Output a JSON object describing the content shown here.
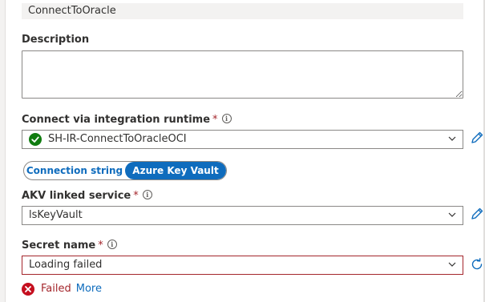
{
  "name_field": {
    "value": "ConnectToOracle"
  },
  "description": {
    "label": "Description",
    "value": ""
  },
  "integration_runtime": {
    "label": "Connect via integration runtime",
    "required_mark": "*",
    "info_icon": "info-icon",
    "selected": "SH-IR-ConnectToOracleOCI",
    "status_icon": "check-circle-icon",
    "status_color": "#107c10"
  },
  "auth_toggle": {
    "options": [
      "Connection string",
      "Azure Key Vault"
    ],
    "selected": "Azure Key Vault",
    "accent": "#0f6cbd"
  },
  "akv_linked_service": {
    "label": "AKV linked service",
    "required_mark": "*",
    "info_icon": "info-icon",
    "selected": "lsKeyVault"
  },
  "secret_name": {
    "label": "Secret name",
    "required_mark": "*",
    "info_icon": "info-icon",
    "selected": "Loading failed",
    "error_color": "#a4262c"
  },
  "status": {
    "icon": "error-circle-icon",
    "text": "Failed",
    "link": "More"
  }
}
